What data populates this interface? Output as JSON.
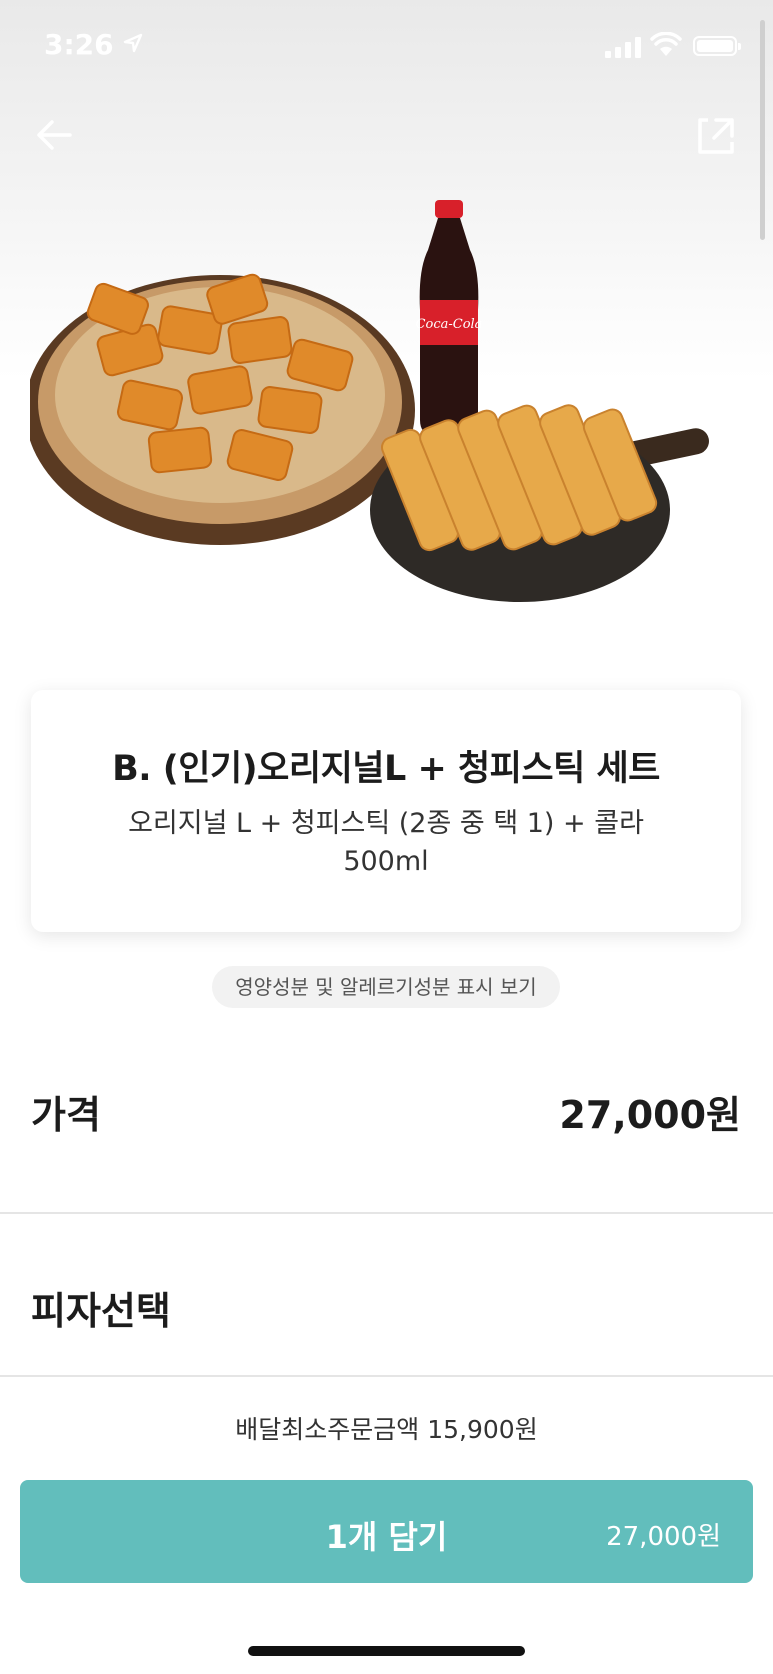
{
  "status_bar": {
    "time": "3:26"
  },
  "product": {
    "title": "B. (인기)오리지널L + 청피스틱 세트",
    "description": "오리지널 L + 청피스틱 (2종 중 택 1) + 콜라 500ml",
    "nutrition_link": "영양성분 및 알레르기성분 표시 보기"
  },
  "price": {
    "label": "가격",
    "value": "27,000원"
  },
  "pizza_select": {
    "label": "피자선택"
  },
  "footer": {
    "min_order": "배달최소주문금액 15,900원",
    "add_button_label": "1개 담기",
    "add_button_price": "27,000원"
  },
  "colors": {
    "accent": "#62bebc"
  }
}
